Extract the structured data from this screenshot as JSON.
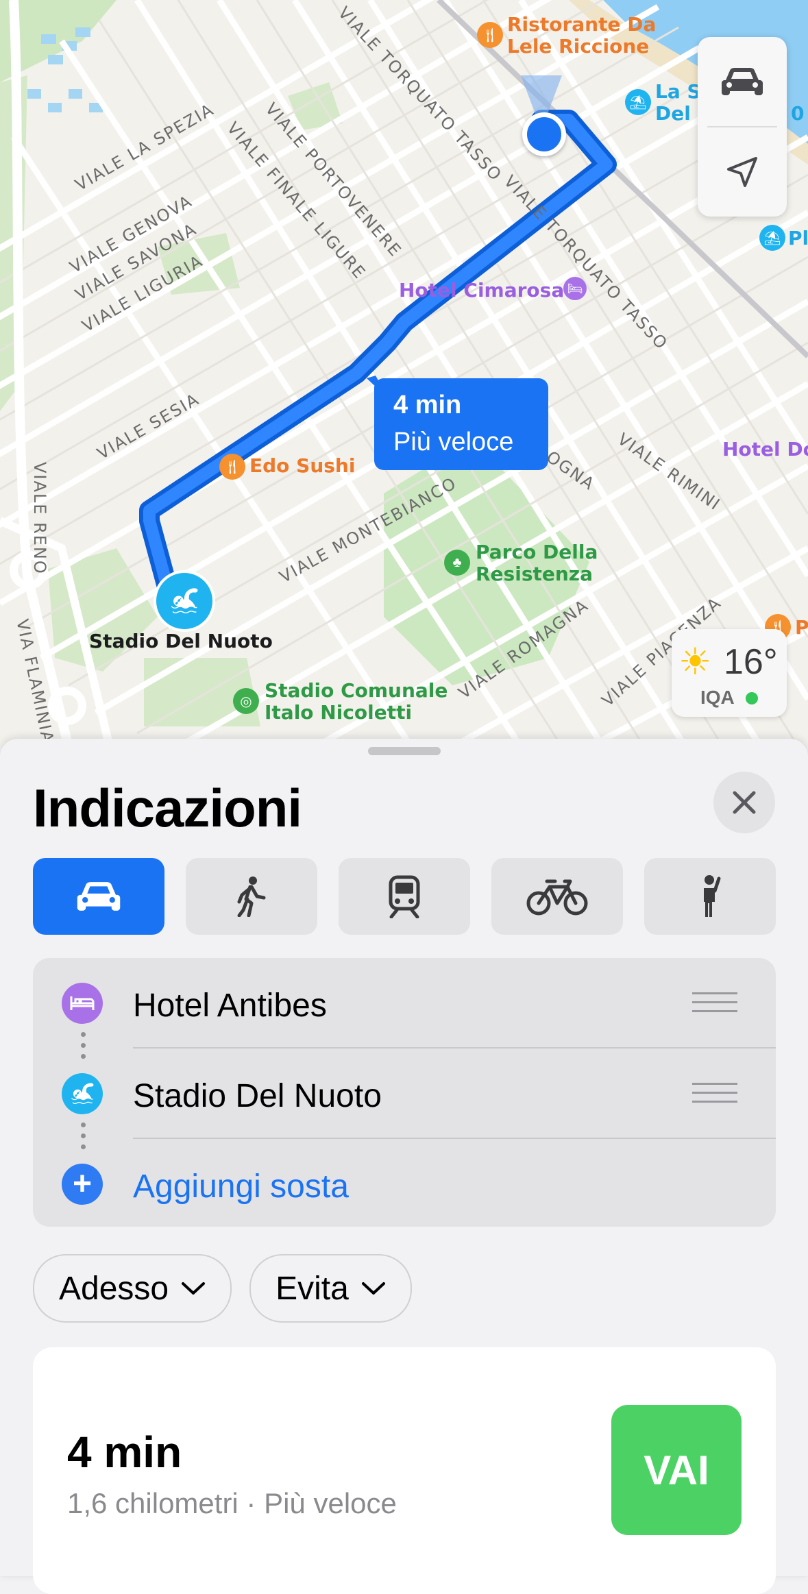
{
  "map": {
    "streets": [
      "VIALE TORQUATO TASSO",
      "VIALE TORQUATO TASSO",
      "VIALE PORTOVENERE",
      "VIALE FINALE LIGURE",
      "VIALE LA SPEZIA",
      "VIALE GENOVA",
      "VIALE SAVONA",
      "VIALE LIGURIA",
      "VIALE SESIA",
      "VIALE RENO",
      "VIA FLAMINIA",
      "VIALE MONTEBIANCO",
      "VIALE RIMINI",
      "VIALE ROMAGNA",
      "VIALE PIACENZA",
      "OGNA"
    ],
    "pois": {
      "ristorante": "Ristorante Da\nLele Riccione",
      "ristorante_line1": "Ristorante Da",
      "ristorante_line2": "Lele Riccione",
      "beach1_line1": "La S",
      "beach1_line2": "Del",
      "beach1_suffix": "0",
      "beach2": "Pl",
      "hotel_cimarosa": "Hotel Cimarosa",
      "hotel_right": "Hotel Do",
      "edo_sushi": "Edo Sushi",
      "parco_line1": "Parco Della",
      "parco_line2": "Resistenza",
      "stadio_nuoto": "Stadio Del Nuoto",
      "stadio_comunale_line1": "Stadio Comunale",
      "stadio_comunale_line2": "Italo Nicoletti",
      "right_poi": "P"
    },
    "route_bubble": {
      "time": "4 min",
      "label": "Più veloce"
    },
    "weather": {
      "temp": "16°",
      "aqi_label": "IQA",
      "aqi_color": "#34c759"
    },
    "controls": {
      "transport_icon": "car-icon",
      "location_icon": "location-arrow-icon"
    }
  },
  "sheet": {
    "title": "Indicazioni",
    "modes": [
      {
        "name": "car",
        "icon": "car-icon",
        "active": true
      },
      {
        "name": "walk",
        "icon": "walk-icon",
        "active": false
      },
      {
        "name": "transit",
        "icon": "train-icon",
        "active": false
      },
      {
        "name": "bike",
        "icon": "bike-icon",
        "active": false
      },
      {
        "name": "rideshare",
        "icon": "person-hail-icon",
        "active": false
      }
    ],
    "stops": [
      {
        "label": "Hotel Antibes",
        "icon": "bed-icon",
        "color": "#a971e8"
      },
      {
        "label": "Stadio Del Nuoto",
        "icon": "swim-icon",
        "color": "#1fb4ef"
      }
    ],
    "add_stop": "Aggiungi sosta",
    "time_pill": "Adesso",
    "avoid_pill": "Evita",
    "route": {
      "time": "4 min",
      "details": "1,6 chilometri · Più veloce",
      "go": "VAI"
    }
  },
  "colors": {
    "accent": "#1a73f2",
    "route": "#1a73f2",
    "go": "#4cd264"
  }
}
